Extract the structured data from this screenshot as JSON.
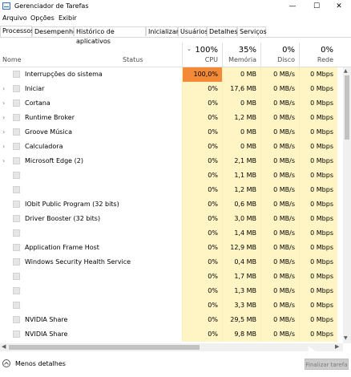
{
  "window": {
    "title": "Gerenciador de Tarefas",
    "min": "—",
    "max": "☐",
    "close": "✕"
  },
  "menu": [
    "Arquivo",
    "Opções",
    "Exibir"
  ],
  "tabs": [
    "Processos",
    "Desempenho",
    "Histórico de aplicativos",
    "Inicializar",
    "Usuários",
    "Detalhes",
    "Serviços"
  ],
  "active_tab": "Processos",
  "columns": {
    "name": "Nome",
    "status": "Status",
    "cpu": {
      "pct": "100%",
      "label": "CPU"
    },
    "memory": {
      "pct": "35%",
      "label": "Memória"
    },
    "disk": {
      "pct": "0%",
      "label": "Disco"
    },
    "network": {
      "pct": "0%",
      "label": "Rede"
    }
  },
  "processes": [
    {
      "name": "Interrupções do sistema",
      "expandable": false,
      "cpu": "100,0%",
      "mem": "0 MB",
      "disk": "0 MB/s",
      "net": "0 Mbps",
      "cpu_hot": true
    },
    {
      "name": "Iniciar",
      "expandable": true,
      "cpu": "0%",
      "mem": "17,6 MB",
      "disk": "0 MB/s",
      "net": "0 Mbps"
    },
    {
      "name": "Cortana",
      "expandable": true,
      "cpu": "0%",
      "mem": "0 MB",
      "disk": "0 MB/s",
      "net": "0 Mbps"
    },
    {
      "name": "Runtime Broker",
      "expandable": true,
      "cpu": "0%",
      "mem": "1,2 MB",
      "disk": "0 MB/s",
      "net": "0 Mbps"
    },
    {
      "name": "Groove Música",
      "expandable": true,
      "cpu": "0%",
      "mem": "0 MB",
      "disk": "0 MB/s",
      "net": "0 Mbps"
    },
    {
      "name": "Calculadora",
      "expandable": true,
      "cpu": "0%",
      "mem": "0 MB",
      "disk": "0 MB/s",
      "net": "0 Mbps"
    },
    {
      "name": "Microsoft Edge (2)",
      "expandable": true,
      "cpu": "0%",
      "mem": "2,1 MB",
      "disk": "0 MB/s",
      "net": "0 Mbps"
    },
    {
      "name": "",
      "expandable": false,
      "cpu": "0%",
      "mem": "1,1 MB",
      "disk": "0 MB/s",
      "net": "0 Mbps"
    },
    {
      "name": "",
      "expandable": false,
      "cpu": "0%",
      "mem": "1,2 MB",
      "disk": "0 MB/s",
      "net": "0 Mbps"
    },
    {
      "name": "IObit Public Program (32 bits)",
      "expandable": false,
      "cpu": "0%",
      "mem": "0,6 MB",
      "disk": "0 MB/s",
      "net": "0 Mbps"
    },
    {
      "name": "Driver Booster (32 bits)",
      "expandable": false,
      "cpu": "0%",
      "mem": "3,0 MB",
      "disk": "0 MB/s",
      "net": "0 Mbps"
    },
    {
      "name": "",
      "expandable": false,
      "cpu": "0%",
      "mem": "1,4 MB",
      "disk": "0 MB/s",
      "net": "0 Mbps"
    },
    {
      "name": "Application Frame Host",
      "expandable": false,
      "cpu": "0%",
      "mem": "12,9 MB",
      "disk": "0 MB/s",
      "net": "0 Mbps"
    },
    {
      "name": "Windows Security Health Service",
      "expandable": false,
      "cpu": "0%",
      "mem": "0,4 MB",
      "disk": "0 MB/s",
      "net": "0 Mbps"
    },
    {
      "name": "",
      "expandable": false,
      "cpu": "0%",
      "mem": "1,7 MB",
      "disk": "0 MB/s",
      "net": "0 Mbps"
    },
    {
      "name": "",
      "expandable": false,
      "cpu": "0%",
      "mem": "1,3 MB",
      "disk": "0 MB/s",
      "net": "0 Mbps"
    },
    {
      "name": "",
      "expandable": false,
      "cpu": "0%",
      "mem": "3,3 MB",
      "disk": "0 MB/s",
      "net": "0 Mbps"
    },
    {
      "name": "NVIDIA Share",
      "expandable": false,
      "cpu": "0%",
      "mem": "29,5 MB",
      "disk": "0 MB/s",
      "net": "0 Mbps"
    },
    {
      "name": "NVIDIA Share",
      "expandable": false,
      "cpu": "0%",
      "mem": "9,8 MB",
      "disk": "0 MB/s",
      "net": "0 Mbps"
    }
  ],
  "footer": {
    "less_details": "Menos detalhes",
    "end_task": "Finalizar tarefa"
  },
  "colors": {
    "cell_bg": "#fff4c4",
    "cpu_hot": "#f28a38"
  }
}
